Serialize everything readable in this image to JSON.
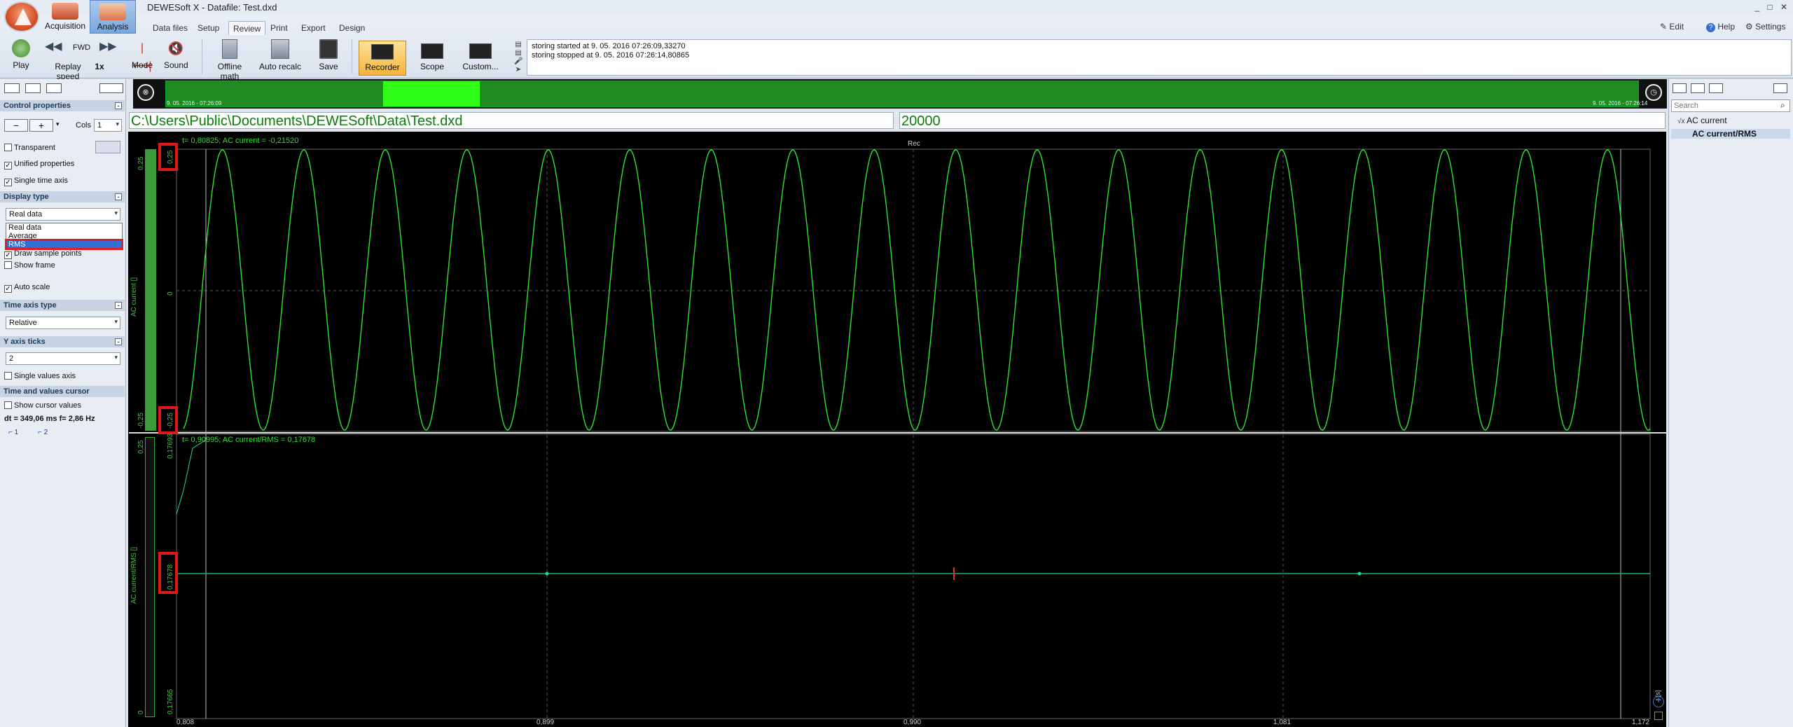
{
  "window": {
    "title": "DEWESoft X - Datafile: Test.dxd",
    "controls": [
      "_",
      "□",
      "✕"
    ]
  },
  "modes": [
    {
      "label": "Acquisition",
      "active": false
    },
    {
      "label": "Analysis",
      "active": true
    }
  ],
  "tabs": [
    {
      "label": "Data files",
      "active": false
    },
    {
      "label": "Setup",
      "active": false
    },
    {
      "label": "Review",
      "active": true
    },
    {
      "label": "Print",
      "active": false
    },
    {
      "label": "Export",
      "active": false
    },
    {
      "label": "Design",
      "active": false
    }
  ],
  "topright": {
    "edit": "Edit",
    "help": "Help",
    "settings": "Settings"
  },
  "toolbar": {
    "play": "Play",
    "fwd": "FWD",
    "replay_speed": "Replay speed",
    "replay_speed_value": "1x",
    "mode": "Mode",
    "sound": "Sound",
    "offline_math": "Offline math",
    "auto_recalc": "Auto recalc",
    "save": "Save",
    "recorder": "Recorder",
    "scope": "Scope",
    "custom": "Custom..."
  },
  "messages": [
    "storing started at 9. 05. 2016 07:26:09,33270",
    "storing stopped at 9. 05. 2016 07:26:14,80865"
  ],
  "left_panel": {
    "control_properties": "Control properties",
    "cols_label": "Cols",
    "cols_value": "1",
    "transparent": "Transparent",
    "unified_properties": "Unified properties",
    "single_time_axis": "Single time axis",
    "display_type": "Display type",
    "display_type_value": "Real data",
    "display_options": [
      "Real data",
      "Average",
      "RMS"
    ],
    "draw_sample_points": "Draw sample points",
    "show_frame": "Show frame",
    "auto_scale": "Auto scale",
    "time_axis_type": "Time axis type",
    "time_axis_value": "Relative",
    "y_axis_ticks": "Y axis ticks",
    "y_axis_ticks_value": "2",
    "single_values_axis": "Single values axis",
    "time_values_cursor": "Time and values cursor",
    "show_cursor_values": "Show cursor values",
    "dt_value": "dt = 349,06 ms  f= 2,86 Hz",
    "cursor1": "1",
    "cursor2": "2"
  },
  "timeline": {
    "start_label": "9. 05. 2016 - 07:26:09",
    "end_label": "9. 05. 2016 - 07:26:14"
  },
  "path_field": "C:\\Users\\Public\\Documents\\DEWESoft\\Data\\Test.dxd",
  "samples_field": "20000",
  "plot1": {
    "cursor_text": "t= 0,80825; AC current = -0,21520",
    "rec_label": "Rec",
    "ylabel": "AC current []",
    "ymax": "0,25",
    "ymid": "0",
    "ymin": "-0,25",
    "ymax_box": "0,25",
    "ymin_box": "-0,25"
  },
  "plot2": {
    "cursor_text": "t= 0,90995; AC current/RMS = 0,17678",
    "ylabel": "AC current/RMS []",
    "ymax": "0,25",
    "ymin": "0",
    "outer_top": "0,17693",
    "mid_box": "0,17678",
    "outer_bottom": "0,17665"
  },
  "x_ticks": [
    "0,808",
    "0,899",
    "0,990",
    "1,081",
    "1,172"
  ],
  "x_unit": "t [s]",
  "right_panel": {
    "search_placeholder": "Search",
    "channels": [
      {
        "label": "AC current",
        "selected": false
      },
      {
        "label": "AC current/RMS",
        "selected": true
      }
    ]
  },
  "colors": {
    "trace": "#2ee52e",
    "rms_trace": "#1fd8a0",
    "grid": "#5a5a5a",
    "highlight": "#e01818"
  }
}
